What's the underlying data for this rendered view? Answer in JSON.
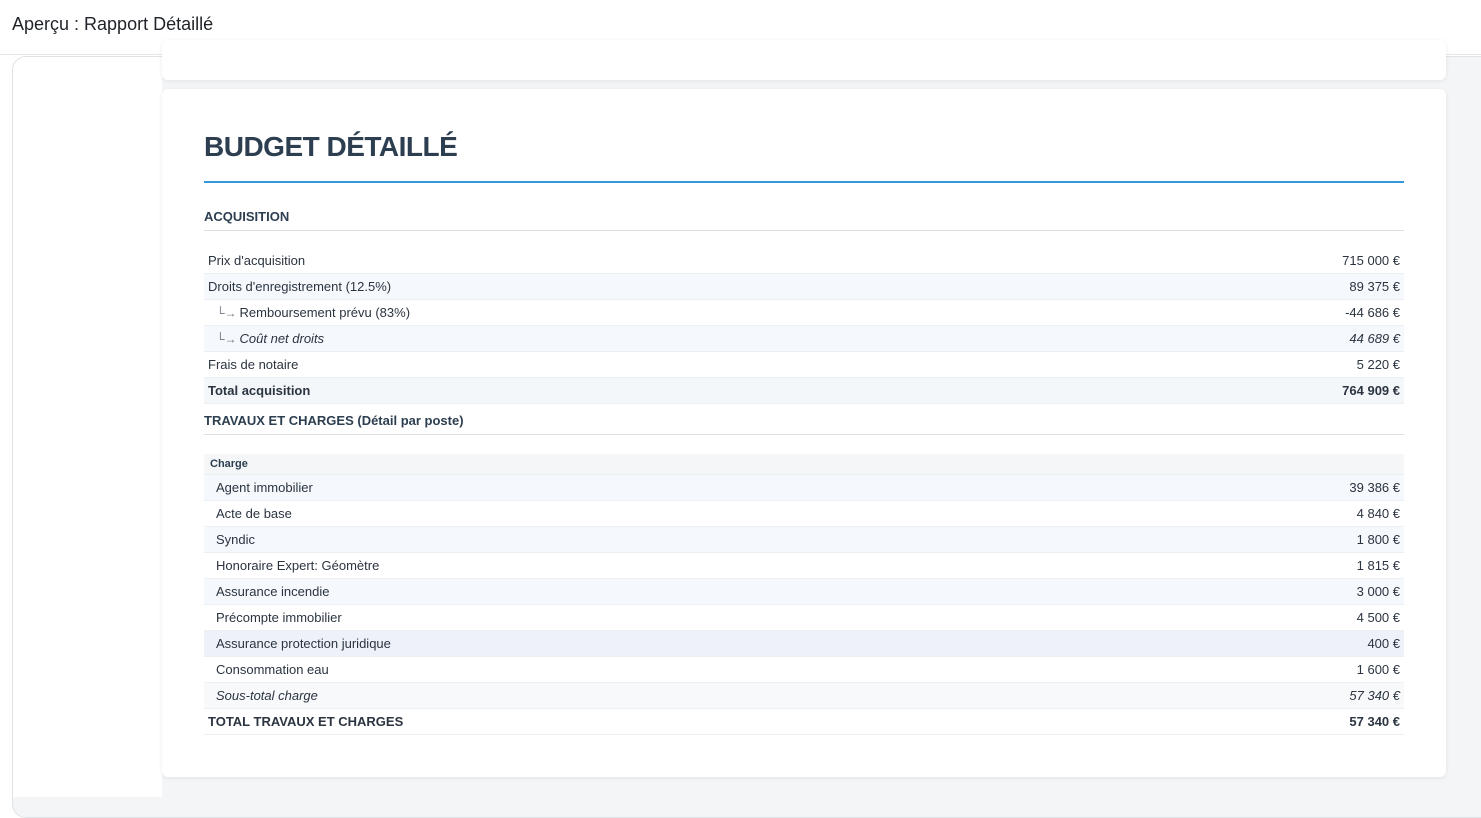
{
  "window": {
    "title": "Aperçu : Rapport Détaillé"
  },
  "report": {
    "title": "BUDGET DÉTAILLÉ",
    "acquisition": {
      "heading": "ACQUISITION",
      "rows": [
        {
          "label": "Prix d'acquisition",
          "value": "715 000 €"
        },
        {
          "label": "Droits d'enregistrement (12.5%)",
          "value": "89 375 €"
        },
        {
          "label": "Remboursement prévu (83%)",
          "value": "-44 686 €",
          "prefix": "└→"
        },
        {
          "label": "Coût net droits",
          "value": "44 689 €",
          "prefix": "└→"
        },
        {
          "label": "Frais de notaire",
          "value": "5 220 €"
        },
        {
          "label": "Total acquisition",
          "value": "764 909 €"
        }
      ]
    },
    "travaux": {
      "heading": "TRAVAUX ET CHARGES (Détail par poste)",
      "group_label": "Charge",
      "rows": [
        {
          "label": "Agent immobilier",
          "value": "39 386 €"
        },
        {
          "label": "Acte de base",
          "value": "4 840 €"
        },
        {
          "label": "Syndic",
          "value": "1 800 €"
        },
        {
          "label": "Honoraire Expert: Géomètre",
          "value": "1 815 €"
        },
        {
          "label": "Assurance incendie",
          "value": "3 000 €"
        },
        {
          "label": "Précompte immobilier",
          "value": "4 500 €"
        },
        {
          "label": "Assurance protection juridique",
          "value": "400 €"
        },
        {
          "label": "Consommation eau",
          "value": "1 600 €"
        }
      ],
      "subtotal": {
        "label": "Sous-total charge",
        "value": "57 340 €"
      },
      "total": {
        "label": "TOTAL TRAVAUX ET CHARGES",
        "value": "57 340 €"
      }
    }
  }
}
